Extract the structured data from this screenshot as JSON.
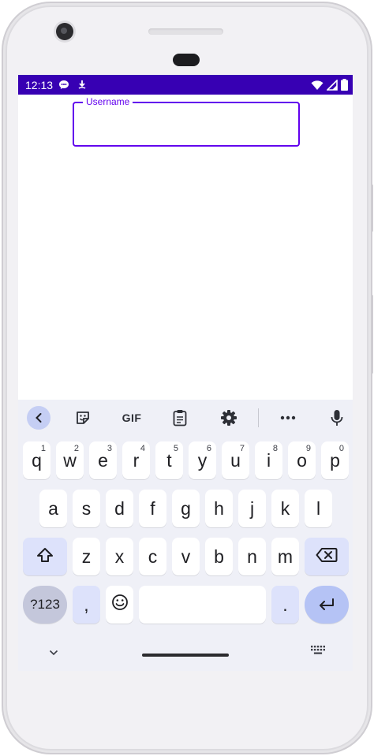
{
  "status_bar": {
    "time": "12:13",
    "left_icons": [
      "chat-icon",
      "download-icon"
    ],
    "right_icons": [
      "wifi-icon",
      "signal-icon",
      "battery-icon"
    ],
    "bg_color": "#3700b3"
  },
  "text_field": {
    "label": "Username",
    "value": "",
    "accent_color": "#6200ee"
  },
  "keyboard_toolbar": {
    "items": [
      "back-chevron-icon",
      "sticker-icon",
      "gif-button",
      "clipboard-icon",
      "gear-icon",
      "more-icon",
      "microphone-icon"
    ],
    "gif_label": "GIF"
  },
  "keyboard": {
    "row1": [
      {
        "key": "q",
        "hint": "1"
      },
      {
        "key": "w",
        "hint": "2"
      },
      {
        "key": "e",
        "hint": "3"
      },
      {
        "key": "r",
        "hint": "4"
      },
      {
        "key": "t",
        "hint": "5"
      },
      {
        "key": "y",
        "hint": "6"
      },
      {
        "key": "u",
        "hint": "7"
      },
      {
        "key": "i",
        "hint": "8"
      },
      {
        "key": "o",
        "hint": "9"
      },
      {
        "key": "p",
        "hint": "0"
      }
    ],
    "row2": [
      "a",
      "s",
      "d",
      "f",
      "g",
      "h",
      "j",
      "k",
      "l"
    ],
    "row3": [
      "z",
      "x",
      "c",
      "v",
      "b",
      "n",
      "m"
    ],
    "symbols_label": "?123",
    "comma_label": ",",
    "period_label": "."
  }
}
